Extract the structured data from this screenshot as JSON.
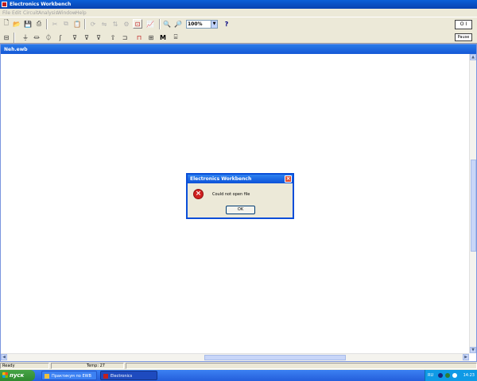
{
  "window": {
    "title": "Electronics Workbench"
  },
  "menu": [
    "File",
    "Edit",
    "Circuit",
    "Analysis",
    "Window",
    "Help"
  ],
  "toolbar": {
    "zoom": "100%",
    "help_label": "?",
    "power_label": "O I",
    "pause_label": "Pause",
    "parts_m_label": "M"
  },
  "document": {
    "title": "Neh.ewb"
  },
  "dialog": {
    "title": "Electronics Workbench",
    "message": "Could not open file",
    "ok_label": "OK"
  },
  "status": {
    "state": "Ready",
    "temp": "Temp: 27"
  },
  "taskbar": {
    "start_label": "пуск",
    "tasks": [
      "Практикум по EWB",
      "Electronics Workbenc..."
    ],
    "lang": "RU",
    "clock": "14:23"
  }
}
